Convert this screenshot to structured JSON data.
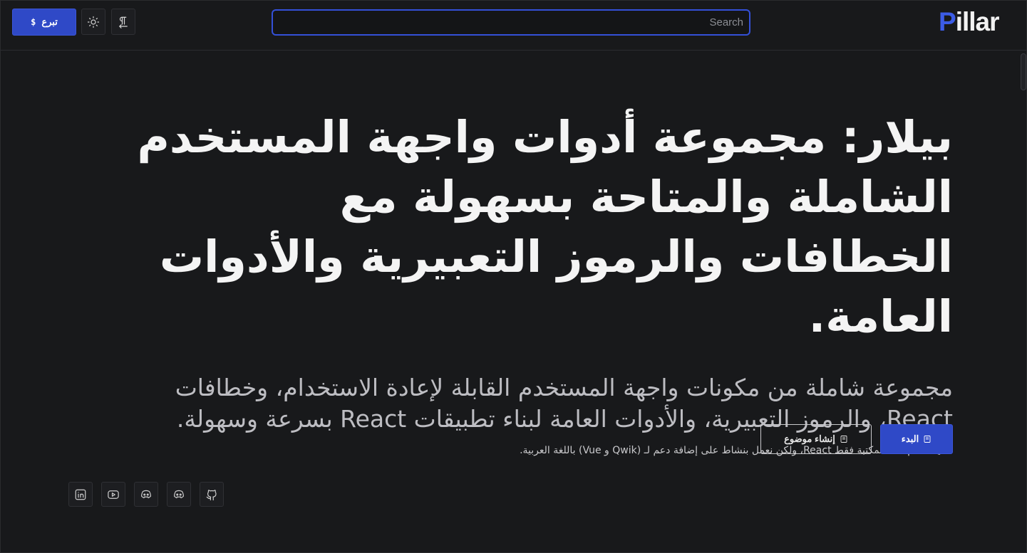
{
  "header": {
    "donate_label": "تبرع",
    "donate_symbol": "$",
    "search_placeholder": "Search",
    "logo_first": "P",
    "logo_rest": "illar"
  },
  "hero": {
    "title": "بيلار: مجموعة أدوات واجهة المستخدم الشاملة والمتاحة بسهولة مع الخطافات والرموز التعبيرية والأدوات العامة.",
    "subtitle": "مجموعة شاملة من مكونات واجهة المستخدم القابلة لإعادة الاستخدام، وخطافات React، والرموز التعبيرية، والأدوات العامة لبناء تطبيقات React بسرعة وسهولة.",
    "note": "حالياً، تدعم هذه المكتبة فقط React، ولكن نعمل بنشاط على إضافة دعم لـ (Qwik و Vue) باللغة العربية."
  },
  "cta": {
    "start_label": "البدء",
    "create_topic_label": "إنشاء موضوع"
  },
  "socials": [
    "linkedin-icon",
    "youtube-icon",
    "discord-icon",
    "discord-icon",
    "github-icon"
  ],
  "colors": {
    "background": "#18191b",
    "accent": "#2f49c7",
    "text": "#f4f4f4"
  }
}
